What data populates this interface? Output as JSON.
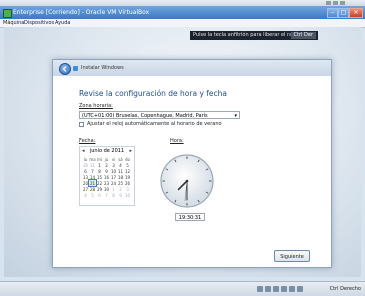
{
  "window": {
    "title": "Enterprise [Corriendo] - Oracle VM VirtualBox",
    "minimize": "–",
    "maximize": "□",
    "close": "✕"
  },
  "menu": [
    "Máquina",
    "Dispositivos",
    "Ayuda"
  ],
  "hostkey_notice": {
    "text": "Pulse la tecla anfitrión para liberar el ratón",
    "button": "Ctrl Der"
  },
  "dialog": {
    "title": "Instalar Windows",
    "heading": "Revise la configuración de hora y fecha",
    "timezone_label": "Zona horaria:",
    "timezone_value": "(UTC+01:00) Bruselas, Copenhague, Madrid, París",
    "dst_checkbox": "Ajustar el reloj automáticamente al horario de verano",
    "date_label": "Fecha:",
    "time_label": "Hora:",
    "calendar": {
      "month": "junio de 2011",
      "prev": "◂",
      "next": "▸",
      "weekdays": [
        "lu",
        "ma",
        "mi",
        "ju",
        "vi",
        "sá",
        "do"
      ],
      "weeks": [
        [
          "30",
          "31",
          "1",
          "2",
          "3",
          "4",
          "5"
        ],
        [
          "6",
          "7",
          "8",
          "9",
          "10",
          "11",
          "12"
        ],
        [
          "13",
          "14",
          "15",
          "16",
          "17",
          "18",
          "19"
        ],
        [
          "20",
          "21",
          "22",
          "23",
          "24",
          "25",
          "26"
        ],
        [
          "27",
          "28",
          "29",
          "30",
          "1",
          "2",
          "3"
        ],
        [
          "4",
          "5",
          "6",
          "7",
          "8",
          "9",
          "10"
        ]
      ],
      "selected": "21"
    },
    "clock": {
      "hour": 7,
      "minute": 30,
      "second": 31
    },
    "time_value": "19:30:31",
    "next_button": "Siguiente"
  },
  "statusbar": {
    "hostkey": "Ctrl Derecho"
  },
  "colors": {
    "titlebar": "#3d78c2",
    "heading": "#1f4f8a",
    "close": "#c4402a"
  }
}
